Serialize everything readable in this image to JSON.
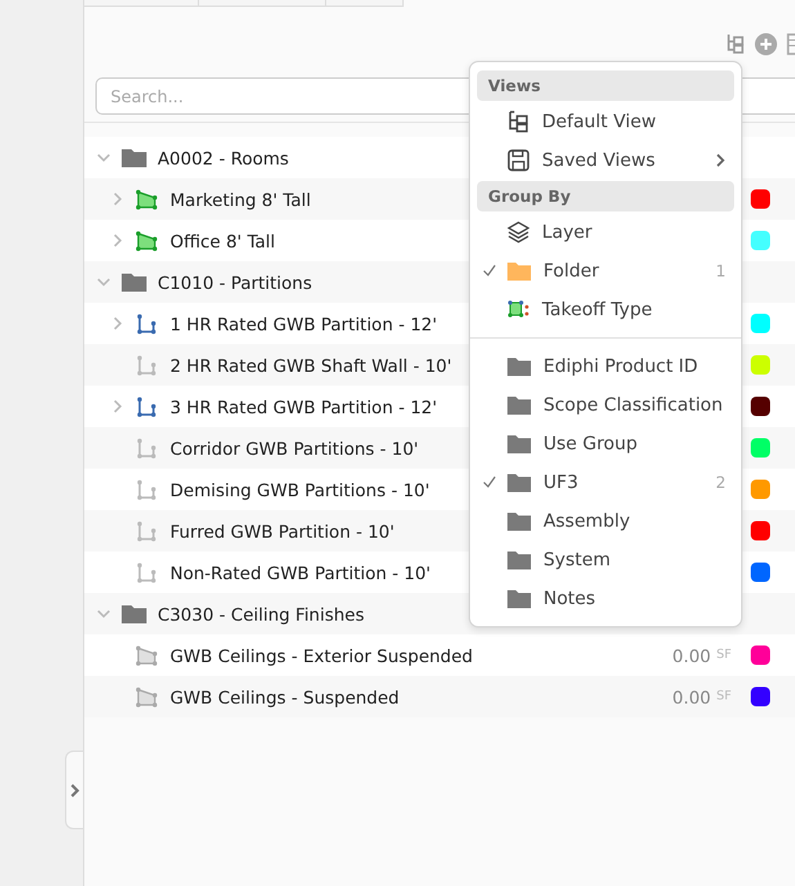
{
  "search": {
    "placeholder": "Search..."
  },
  "tree": [
    {
      "label": "A0002 - Rooms",
      "expanded": true,
      "children": [
        {
          "label": "Marketing 8' Tall",
          "kind": "area",
          "measured": true,
          "expandable": true,
          "color": "#ff0000"
        },
        {
          "label": "Office 8' Tall",
          "kind": "area",
          "measured": true,
          "expandable": true,
          "color": "#44ffff"
        }
      ]
    },
    {
      "label": "C1010 - Partitions",
      "expanded": true,
      "children": [
        {
          "label": "1 HR Rated GWB Partition - 12'",
          "kind": "linear",
          "measured": true,
          "expandable": true,
          "color": "#00ffff"
        },
        {
          "label": "2 HR Rated GWB Shaft Wall - 10'",
          "kind": "linear",
          "measured": false,
          "expandable": false,
          "color": "#ccff00"
        },
        {
          "label": "3 HR Rated GWB Partition - 12'",
          "kind": "linear",
          "measured": true,
          "expandable": true,
          "color": "#550000"
        },
        {
          "label": "Corridor GWB Partitions - 10'",
          "kind": "linear",
          "measured": false,
          "expandable": false,
          "color": "#00ff66"
        },
        {
          "label": "Demising GWB Partitions - 10'",
          "kind": "linear",
          "measured": false,
          "expandable": false,
          "color": "#ff9900"
        },
        {
          "label": "Furred GWB Partition - 10'",
          "kind": "linear",
          "measured": false,
          "expandable": false,
          "color": "#ff0000"
        },
        {
          "label": "Non-Rated GWB Partition - 10'",
          "kind": "linear",
          "measured": false,
          "expandable": false,
          "color": "#0066ff"
        }
      ]
    },
    {
      "label": "C3030 - Ceiling Finishes",
      "expanded": true,
      "children": [
        {
          "label": "GWB Ceilings - Exterior Suspended",
          "kind": "area",
          "measured": false,
          "expandable": false,
          "color": "#ff0099",
          "quantity": "0.00",
          "unit": "SF"
        },
        {
          "label": "GWB Ceilings - Suspended",
          "kind": "area",
          "measured": false,
          "expandable": false,
          "color": "#3300ff",
          "quantity": "0.00",
          "unit": "SF"
        }
      ]
    }
  ],
  "menu": {
    "sections": [
      {
        "header": "Views",
        "items": [
          {
            "label": "Default View",
            "kind": "tree",
            "checked": false,
            "submenu": false
          },
          {
            "label": "Saved Views",
            "kind": "save",
            "checked": false,
            "submenu": true
          }
        ]
      },
      {
        "header": "Group By",
        "items": [
          {
            "label": "Layer",
            "kind": "layers",
            "checked": false,
            "submenu": false
          },
          {
            "label": "Folder",
            "kind": "folder-open",
            "checked": true,
            "count": "1",
            "submenu": false
          },
          {
            "label": "Takeoff Type",
            "kind": "takeoff",
            "checked": false,
            "submenu": false
          }
        ]
      },
      {
        "items": [
          {
            "label": "Ediphi Product ID",
            "kind": "folder",
            "checked": false,
            "submenu": false
          },
          {
            "label": "Scope Classification",
            "kind": "folder",
            "checked": false,
            "submenu": false
          },
          {
            "label": "Use Group",
            "kind": "folder",
            "checked": false,
            "submenu": false
          },
          {
            "label": "UF3",
            "kind": "folder",
            "checked": true,
            "count": "2",
            "submenu": false
          },
          {
            "label": "Assembly",
            "kind": "folder",
            "checked": false,
            "submenu": false
          },
          {
            "label": "System",
            "kind": "folder",
            "checked": false,
            "submenu": false
          },
          {
            "label": "Notes",
            "kind": "folder",
            "checked": false,
            "submenu": false
          }
        ]
      }
    ]
  }
}
